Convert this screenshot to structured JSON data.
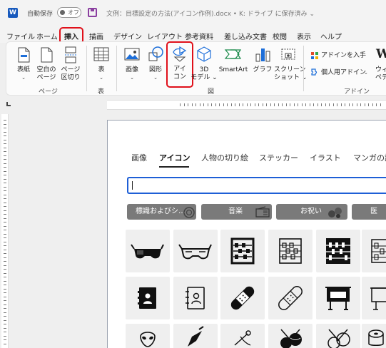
{
  "titlebar": {
    "app_logo": "W",
    "autosave_label": "自動保存",
    "autosave_state": "オフ",
    "document_title": "文例：目標設定の方法(アイコン作例).docx • K: ドライブ に保存済み ⌄"
  },
  "menu": {
    "tabs": [
      "ファイル",
      "ホーム",
      "挿入",
      "描画",
      "デザイン",
      "レイアウト",
      "参考資料",
      "差し込み文書",
      "校閲",
      "表示",
      "ヘルプ"
    ],
    "active": "挿入"
  },
  "ribbon": {
    "cover_page": "表紙",
    "cover_page_chev": "⌄",
    "blank_page_1": "空白の",
    "blank_page_2": "ページ",
    "page_break_1": "ページ",
    "page_break_2": "区切り",
    "group_pages": "ページ",
    "table": "表",
    "table_chev": "⌄",
    "group_table": "表",
    "pictures": "画像",
    "pictures_chev": "⌄",
    "shapes": "図形",
    "shapes_chev": "⌄",
    "icons_1": "アイ",
    "icons_2": "コン",
    "models_1": "3D",
    "models_2": "モデル ⌄",
    "smartart": "SmartArt",
    "chart": "グラフ",
    "screenshot_1": "スクリーン",
    "screenshot_2": "ショット ⌄",
    "group_illustrations": "図",
    "get_addins": "アドインを入手",
    "my_addins": "個人用アドイン",
    "my_addins_chev": "⌄",
    "wiki_1": "ウィ",
    "wiki_2": "ペデ",
    "group_addins": "アドイン"
  },
  "dialog": {
    "tabs": [
      "画像",
      "アイコン",
      "人物の切り絵",
      "ステッカー",
      "イラスト",
      "マンガの読"
    ],
    "active_tab": "アイコン",
    "search_value": "",
    "categories": [
      "標識およびシ…",
      "音楽",
      "お祝い",
      "医"
    ],
    "icons": [
      [
        "3d-glasses-filled",
        "3d-glasses-outline",
        "abacus-filled",
        "abacus-outline",
        "abacus-dark",
        "abacus-partial"
      ],
      [
        "address-book-filled",
        "address-book-outline",
        "bandage-filled",
        "bandage-outline",
        "billboard-filled",
        "billboard-outline"
      ],
      [
        "alien-outline",
        "pen-nib",
        "cotton-swab",
        "yarn-balls-filled",
        "yarn-balls-outline",
        "fabric-roll"
      ]
    ]
  }
}
